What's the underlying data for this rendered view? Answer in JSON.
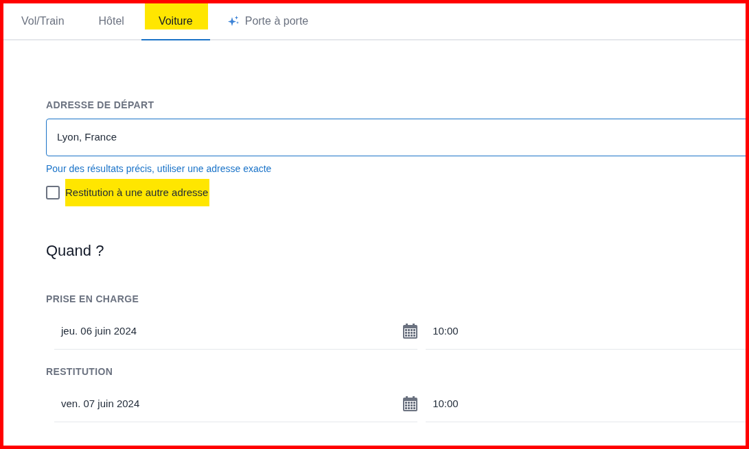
{
  "tabs": [
    {
      "label": "Vol/Train",
      "selected": false,
      "highlighted": false,
      "kind": "plain"
    },
    {
      "label": "Hôtel",
      "selected": false,
      "highlighted": false,
      "kind": "plain"
    },
    {
      "label": "Voiture",
      "selected": true,
      "highlighted": true,
      "kind": "plain"
    },
    {
      "label": "Porte à porte",
      "selected": false,
      "highlighted": false,
      "kind": "featured"
    }
  ],
  "departure": {
    "label": "ADRESSE DE DÉPART",
    "value": "Lyon, France",
    "hint": "Pour des résultats précis, utiliser une adresse exacte"
  },
  "return_elsewhere": {
    "label": "Restitution à une autre adresse",
    "checked": false,
    "highlighted": true
  },
  "when": {
    "heading": "Quand ?",
    "slots": [
      {
        "label": "PRISE EN CHARGE",
        "date": "jeu. 06 juin 2024",
        "time": "10:00"
      },
      {
        "label": "RESTITUTION",
        "date": "ven. 07 juin 2024",
        "time": "10:00"
      }
    ]
  }
}
